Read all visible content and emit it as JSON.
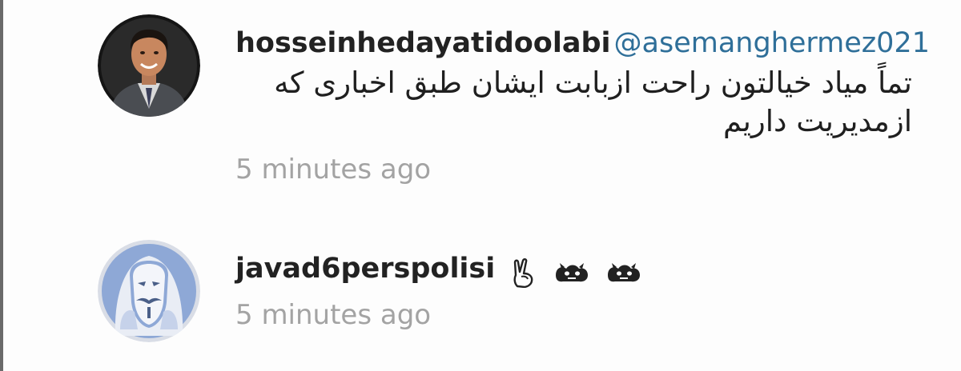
{
  "comments": [
    {
      "username": "hosseinhedayatidoolabi",
      "mention": "@asemanghermez021",
      "text": "تماً میاد خیالتون راحت ازبابت ایشان طبق اخباری که ازمدیریت داریم",
      "timestamp": "5 minutes ago",
      "avatar_icon": "profile-photo"
    },
    {
      "username": "javad6perspolisi",
      "emoji_icons": [
        "victory-hand-icon",
        "emoji-icon",
        "emoji-icon"
      ],
      "timestamp": "5 minutes ago",
      "avatar_icon": "mask-avatar"
    }
  ],
  "colors": {
    "mention": "#2f6f99",
    "timestamp": "#a3a3a3",
    "avatar2_bg": "#8ea8d6"
  }
}
